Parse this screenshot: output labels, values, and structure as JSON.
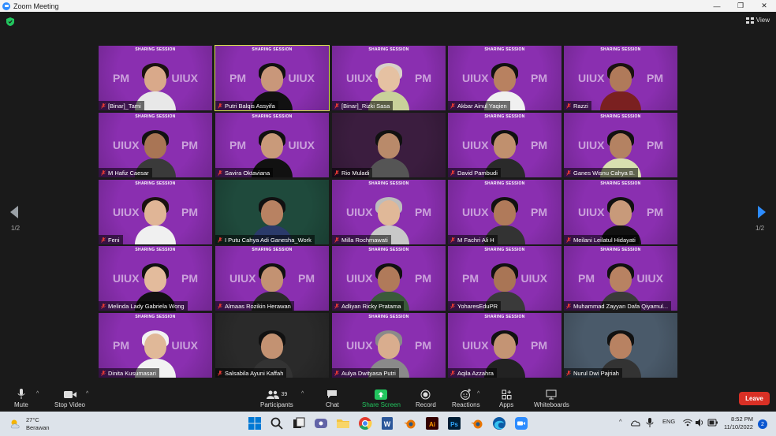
{
  "window": {
    "title": "Zoom Meeting"
  },
  "topbar": {
    "view_label": "View"
  },
  "gallery": {
    "page_left": "1/2",
    "page_right": "1/2",
    "tiles": [
      {
        "name": "[Binar]_Tami",
        "banner": "SHARING SESSION",
        "left": "PM",
        "right": "UIUX",
        "bg": "#8a2fb0",
        "skin": "#d9a98a",
        "hair": "#1a1210",
        "shirt": "#e8e8e8",
        "active": false
      },
      {
        "name": "Putri Balqis Assyifa",
        "banner": "SHARING SESSION",
        "left": "PM",
        "right": "UIUX",
        "bg": "#8a2fb0",
        "skin": "#c9977a",
        "hair": "#111111",
        "shirt": "#111111",
        "active": true
      },
      {
        "name": "[Binar]_Rizki Sasa",
        "banner": "SHARING SESSION",
        "left": "UIUX",
        "right": "PM",
        "bg": "#8a2fb0",
        "skin": "#e5c1a2",
        "hair": "#d8d0c8",
        "shirt": "#c9d19a",
        "active": false
      },
      {
        "name": "Akbar Ainul Yaqien",
        "banner": "SHARING SESSION",
        "left": "UIUX",
        "right": "PM",
        "bg": "#8a2fb0",
        "skin": "#b88160",
        "hair": "#111111",
        "shirt": "#f0f0f0",
        "active": false
      },
      {
        "name": "Razzi",
        "banner": "SHARING SESSION",
        "left": "UIUX",
        "right": "PM",
        "bg": "#8a2fb0",
        "skin": "#b07a5a",
        "hair": "#1a1210",
        "shirt": "#7a2020",
        "active": false
      },
      {
        "name": "M Hafiz Caesar",
        "banner": "SHARING SESSION",
        "left": "UIUX",
        "right": "PM",
        "bg": "#8a2fb0",
        "skin": "#a97555",
        "hair": "#111111",
        "shirt": "#3a3a3a",
        "active": false
      },
      {
        "name": "Savira Oktaviana",
        "banner": "SHARING SESSION",
        "left": "PM",
        "right": "UIUX",
        "bg": "#8a2fb0",
        "skin": "#c99a7a",
        "hair": "#111111",
        "shirt": "#111111",
        "active": false
      },
      {
        "name": "Rio Muladi",
        "banner": "",
        "left": "",
        "right": "",
        "bg": "#3b1d3f",
        "skin": "#b98a6a",
        "hair": "#111111",
        "shirt": "#555555",
        "active": false
      },
      {
        "name": "David Pambudi",
        "banner": "SHARING SESSION",
        "left": "UIUX",
        "right": "PM",
        "bg": "#8a2fb0",
        "skin": "#c0906e",
        "hair": "#111111",
        "shirt": "#2a2a2a",
        "active": false
      },
      {
        "name": "Ganes Wisnu Cahya B.",
        "banner": "SHARING SESSION",
        "left": "UIUX",
        "right": "PM",
        "bg": "#8a2fb0",
        "skin": "#b48262",
        "hair": "#111111",
        "shirt": "#d8e0b0",
        "active": false
      },
      {
        "name": "Feni",
        "banner": "SHARING SESSION",
        "left": "UIUX",
        "right": "PM",
        "bg": "#8a2fb0",
        "skin": "#e0b596",
        "hair": "#1a1210",
        "shirt": "#f0f0f0",
        "active": false
      },
      {
        "name": "I Putu Cahya Adi Ganesha_Work",
        "banner": "",
        "left": "",
        "right": "",
        "bg": "#1f4a3c",
        "skin": "#b88262",
        "hair": "#111111",
        "shirt": "#2a3a6a",
        "active": false
      },
      {
        "name": "Milla Rochmawati",
        "banner": "SHARING SESSION",
        "left": "UIUX",
        "right": "PM",
        "bg": "#8a2fb0",
        "skin": "#e0b898",
        "hair": "#bcbcbc",
        "shirt": "#c8c8c8",
        "active": false
      },
      {
        "name": "M Fachri Ali H",
        "banner": "SHARING SESSION",
        "left": "UIUX",
        "right": "PM",
        "bg": "#8a2fb0",
        "skin": "#b07a5a",
        "hair": "#111111",
        "shirt": "#333333",
        "active": false
      },
      {
        "name": "Meilani Leilatul Hidayati",
        "banner": "SHARING SESSION",
        "left": "UIUX",
        "right": "PM",
        "bg": "#8a2fb0",
        "skin": "#c89a7a",
        "hair": "#111111",
        "shirt": "#111111",
        "active": false
      },
      {
        "name": "Melinda Lady Gabriela Wong",
        "banner": "SHARING SESSION",
        "left": "UIUX",
        "right": "PM",
        "bg": "#8a2fb0",
        "skin": "#e3bb9c",
        "hair": "#111111",
        "shirt": "#111111",
        "active": false
      },
      {
        "name": "Almaas Rozikin Herawan",
        "banner": "SHARING SESSION",
        "left": "UIUX",
        "right": "PM",
        "bg": "#8a2fb0",
        "skin": "#c39272",
        "hair": "#111111",
        "shirt": "#2a2a2a",
        "active": false
      },
      {
        "name": "Adliyan Ricky Pratama",
        "banner": "SHARING SESSION",
        "left": "UIUX",
        "right": "PM",
        "bg": "#8a2fb0",
        "skin": "#b07a5a",
        "hair": "#111111",
        "shirt": "#3a5a3a",
        "active": false
      },
      {
        "name": "YoharesEduPR",
        "banner": "SHARING SESSION",
        "left": "PM",
        "right": "UIUX",
        "bg": "#8a2fb0",
        "skin": "#a97555",
        "hair": "#111111",
        "shirt": "#3a3a3a",
        "active": false
      },
      {
        "name": "Muhammad Zayyan Dafa Qiyamul...",
        "banner": "SHARING SESSION",
        "left": "PM",
        "right": "UIUX",
        "bg": "#8a2fb0",
        "skin": "#b88262",
        "hair": "#111111",
        "shirt": "#3a3a3a",
        "active": false
      },
      {
        "name": "Dinita Kusumasari",
        "banner": "SHARING SESSION",
        "left": "PM",
        "right": "UIUX",
        "bg": "#8a2fb0",
        "skin": "#e0b898",
        "hair": "#f2f2f2",
        "shirt": "#f2f2f2",
        "active": false
      },
      {
        "name": "Salsabila Ayuni Kaffah",
        "banner": "",
        "left": "",
        "right": "",
        "bg": "#2a2a2a",
        "skin": "#c39272",
        "hair": "#111111",
        "shirt": "#333333",
        "active": false
      },
      {
        "name": "Aulya Dwityasa Putri",
        "banner": "SHARING SESSION",
        "left": "UIUX",
        "right": "PM",
        "bg": "#8a2fb0",
        "skin": "#d9ad8e",
        "hair": "#8a8a8a",
        "shirt": "#8a8a8a",
        "active": false
      },
      {
        "name": "Aqila Azzahra",
        "banner": "SHARING SESSION",
        "left": "UIUX",
        "right": "PM",
        "bg": "#8a2fb0",
        "skin": "#c49474",
        "hair": "#111111",
        "shirt": "#222222",
        "active": false
      },
      {
        "name": "Nurul Dwi Pajriah",
        "banner": "",
        "left": "",
        "right": "",
        "bg": "#4a5a6a",
        "skin": "#b88262",
        "hair": "#111111",
        "shirt": "#333333",
        "active": false
      }
    ]
  },
  "toolbar": {
    "mute": "Mute",
    "stop_video": "Stop Video",
    "participants": "Participants",
    "participants_count": "39",
    "chat": "Chat",
    "share_screen": "Share Screen",
    "record": "Record",
    "reactions": "Reactions",
    "apps": "Apps",
    "whiteboards": "Whiteboards",
    "leave": "Leave"
  },
  "colors": {
    "accent_green": "#22c55e",
    "leave_red": "#d93025",
    "active_outline": "#d9e84a",
    "tile_purple": "#8a2fb0"
  },
  "taskbar": {
    "temperature": "27°C",
    "weather": "Berawan",
    "language": "ENG",
    "time": "8:52 PM",
    "date": "11/10/2022",
    "notifications": "2"
  }
}
